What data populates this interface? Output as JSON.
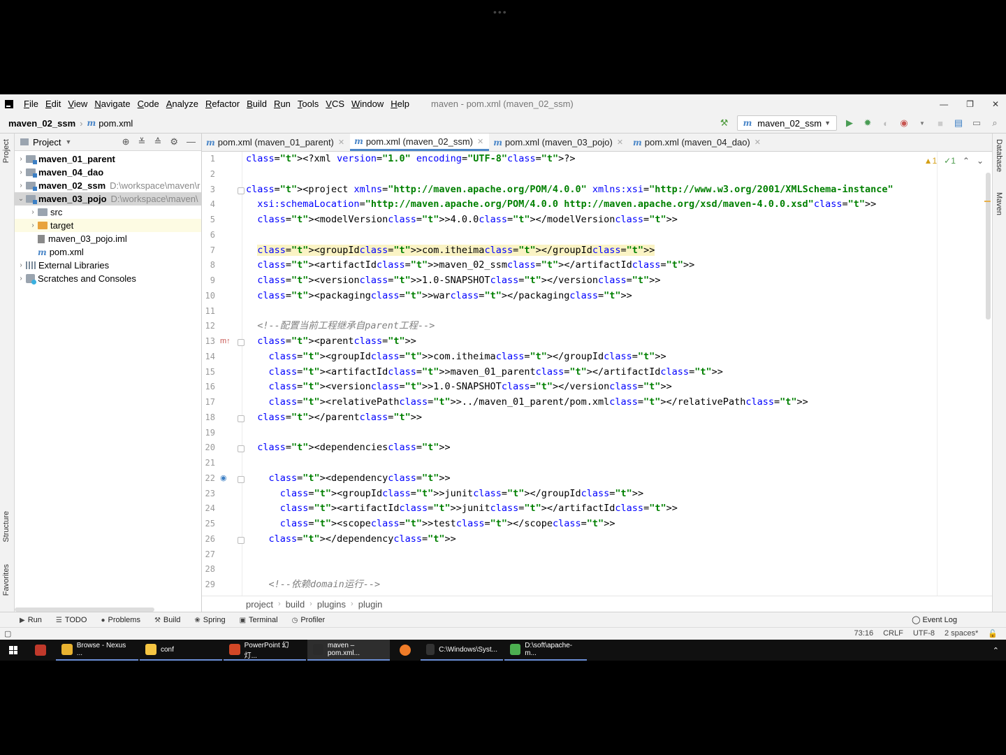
{
  "window": {
    "title": "maven - pom.xml (maven_02_ssm)",
    "controls": [
      "—",
      "❐",
      "✕"
    ]
  },
  "menu": [
    "File",
    "Edit",
    "View",
    "Navigate",
    "Code",
    "Analyze",
    "Refactor",
    "Build",
    "Run",
    "Tools",
    "VCS",
    "Window",
    "Help"
  ],
  "navbar": {
    "project": "maven_02_ssm",
    "file": "pom.xml",
    "run_config": "maven_02_ssm"
  },
  "left_strip": [
    "Project",
    "Structure",
    "Favorites"
  ],
  "right_strip": [
    "Database",
    "Maven"
  ],
  "project_panel": {
    "title": "Project",
    "tree": [
      {
        "label": "maven_01_parent",
        "bold": true,
        "arrow": "›",
        "icon": "module-folder",
        "indent": 0,
        "path": ""
      },
      {
        "label": "maven_04_dao",
        "bold": true,
        "arrow": "›",
        "icon": "module-folder",
        "indent": 0,
        "path": ""
      },
      {
        "label": "maven_02_ssm",
        "bold": true,
        "arrow": "›",
        "icon": "module-folder",
        "indent": 0,
        "path": "D:\\workspace\\maven\\r"
      },
      {
        "label": "maven_03_pojo",
        "bold": true,
        "arrow": "⌄",
        "icon": "module-folder",
        "indent": 0,
        "path": "D:\\workspace\\maven\\",
        "selected": true
      },
      {
        "label": "src",
        "bold": false,
        "arrow": "›",
        "icon": "folder",
        "indent": 1,
        "path": ""
      },
      {
        "label": "target",
        "bold": false,
        "arrow": "›",
        "icon": "folder-orange",
        "indent": 1,
        "path": "",
        "highlight": true
      },
      {
        "label": "maven_03_pojo.iml",
        "bold": false,
        "arrow": "",
        "icon": "iml-file",
        "indent": 1,
        "path": ""
      },
      {
        "label": "pom.xml",
        "bold": false,
        "arrow": "",
        "icon": "maven-file",
        "indent": 1,
        "path": ""
      },
      {
        "label": "External Libraries",
        "bold": false,
        "arrow": "›",
        "icon": "library",
        "indent": 0,
        "path": ""
      },
      {
        "label": "Scratches and Consoles",
        "bold": false,
        "arrow": "›",
        "icon": "scratches",
        "indent": 0,
        "path": ""
      }
    ]
  },
  "tabs": [
    {
      "label": "pom.xml (maven_01_parent)",
      "active": false
    },
    {
      "label": "pom.xml (maven_02_ssm)",
      "active": true
    },
    {
      "label": "pom.xml (maven_03_pojo)",
      "active": false
    },
    {
      "label": "pom.xml (maven_04_dao)",
      "active": false
    }
  ],
  "inspections": {
    "warnings": "▲1",
    "typos": "✓1"
  },
  "code": [
    "<?xml version=\"1.0\" encoding=\"UTF-8\"?>",
    "",
    "<project xmlns=\"http://maven.apache.org/POM/4.0.0\" xmlns:xsi=\"http://www.w3.org/2001/XMLSchema-instance\"",
    "  xsi:schemaLocation=\"http://maven.apache.org/POM/4.0.0 http://maven.apache.org/xsd/maven-4.0.0.xsd\">",
    "  <modelVersion>4.0.0</modelVersion>",
    "",
    "  <groupId>com.itheima</groupId>",
    "  <artifactId>maven_02_ssm</artifactId>",
    "  <version>1.0-SNAPSHOT</version>",
    "  <packaging>war</packaging>",
    "",
    "  <!--配置当前工程继承自parent工程-->",
    "  <parent>",
    "    <groupId>com.itheima</groupId>",
    "    <artifactId>maven_01_parent</artifactId>",
    "    <version>1.0-SNAPSHOT</version>",
    "    <relativePath>../maven_01_parent/pom.xml</relativePath>",
    "  </parent>",
    "",
    "  <dependencies>",
    "",
    "    <dependency>",
    "      <groupId>junit</groupId>",
    "      <artifactId>junit</artifactId>",
    "      <scope>test</scope>",
    "    </dependency>",
    "",
    "",
    "    <!--依赖domain运行-->"
  ],
  "editor_breadcrumb": [
    "project",
    "build",
    "plugins",
    "plugin"
  ],
  "tool_windows": [
    {
      "label": "Run",
      "icon": "▶"
    },
    {
      "label": "TODO",
      "icon": "☰"
    },
    {
      "label": "Problems",
      "icon": "●"
    },
    {
      "label": "Build",
      "icon": "⚒"
    },
    {
      "label": "Spring",
      "icon": "❀"
    },
    {
      "label": "Terminal",
      "icon": "▣"
    },
    {
      "label": "Profiler",
      "icon": "◷"
    }
  ],
  "event_log": "Event Log",
  "status": {
    "position": "73:16",
    "line_sep": "CRLF",
    "encoding": "UTF-8",
    "indent": "2 spaces*"
  },
  "taskbar": [
    {
      "label": "",
      "color": "#c0392b"
    },
    {
      "label": "Browse - Nexus ...",
      "color": "#e8b230"
    },
    {
      "label": "conf",
      "color": "#f5c542"
    },
    {
      "label": "PowerPoint 幻灯...",
      "color": "#d24726"
    },
    {
      "label": "maven – pom.xml...",
      "color": "#2b2b2b",
      "active": true
    },
    {
      "label": "",
      "color": "#f07c28"
    },
    {
      "label": "C:\\Windows\\Syst...",
      "color": "#333333"
    },
    {
      "label": "D:\\soft\\apache-m...",
      "color": "#4caf50"
    }
  ]
}
